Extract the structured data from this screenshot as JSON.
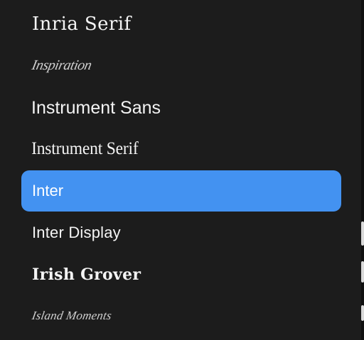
{
  "font_list": {
    "items": [
      {
        "label": "Inria Serif",
        "selected": false
      },
      {
        "label": "Inspiration",
        "selected": false
      },
      {
        "label": "Instrument Sans",
        "selected": false
      },
      {
        "label": "Instrument Serif",
        "selected": false
      },
      {
        "label": "Inter",
        "selected": true
      },
      {
        "label": "Inter Display",
        "selected": false
      },
      {
        "label": "Irish Grover",
        "selected": false
      },
      {
        "label": "Island Moments",
        "selected": false
      }
    ],
    "selected_label": "Inter",
    "colors": {
      "background": "#1c1c1c",
      "text": "#f4f4f4",
      "selected_background": "#4392f1",
      "selected_text": "#ffffff"
    }
  }
}
